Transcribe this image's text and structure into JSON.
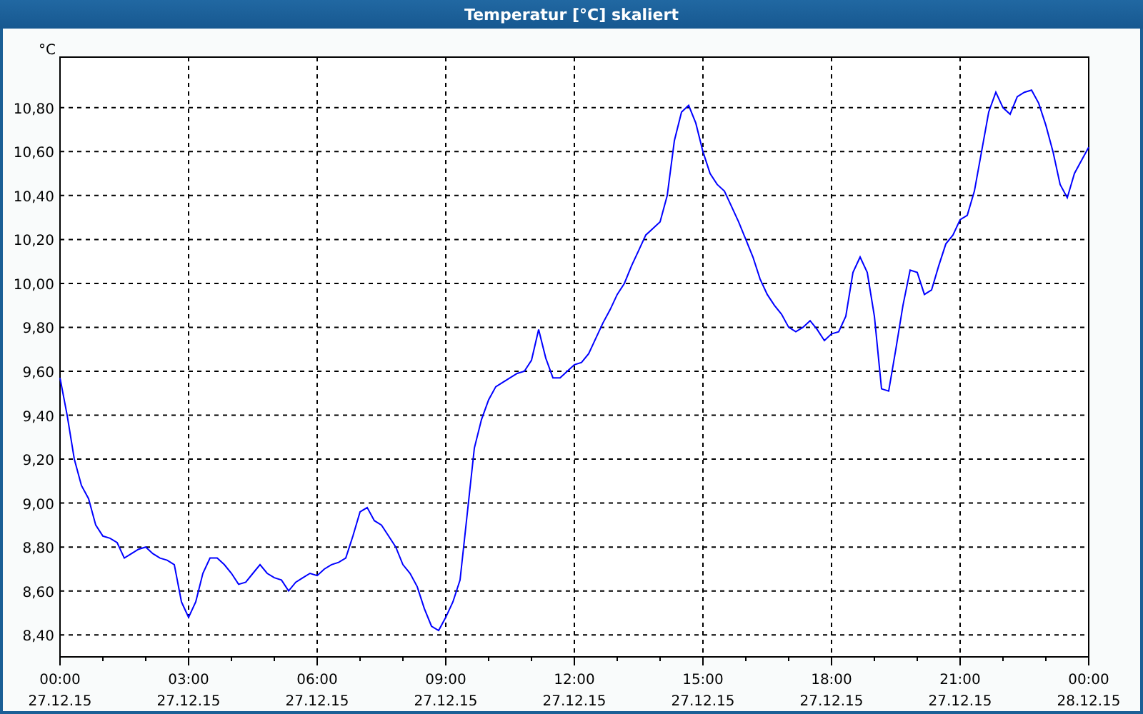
{
  "window": {
    "title": "Temperatur [°C] skaliert"
  },
  "chart_data": {
    "type": "line",
    "ylabel": "°C",
    "ylim": [
      8.3,
      11.03
    ],
    "grid": true,
    "yticks": [
      {
        "value": 8.4,
        "label": "8,40"
      },
      {
        "value": 8.6,
        "label": "8,60"
      },
      {
        "value": 8.8,
        "label": "8,80"
      },
      {
        "value": 9.0,
        "label": "9,00"
      },
      {
        "value": 9.2,
        "label": "9,20"
      },
      {
        "value": 9.4,
        "label": "9,40"
      },
      {
        "value": 9.6,
        "label": "9,60"
      },
      {
        "value": 9.8,
        "label": "9,80"
      },
      {
        "value": 10.0,
        "label": "10,00"
      },
      {
        "value": 10.2,
        "label": "10,20"
      },
      {
        "value": 10.4,
        "label": "10,40"
      },
      {
        "value": 10.6,
        "label": "10,60"
      },
      {
        "value": 10.8,
        "label": "10,80"
      }
    ],
    "categories": [
      "00:00 27.12.15",
      null,
      null,
      null,
      null,
      null,
      null,
      null,
      null,
      null,
      null,
      null,
      null,
      null,
      null,
      null,
      null,
      null,
      "03:00 27.12.15",
      null,
      null,
      null,
      null,
      null,
      null,
      null,
      null,
      null,
      null,
      null,
      null,
      null,
      null,
      null,
      null,
      null,
      "06:00 27.12.15",
      null,
      null,
      null,
      null,
      null,
      null,
      null,
      null,
      null,
      null,
      null,
      null,
      null,
      null,
      null,
      null,
      null,
      "09:00 27.12.15",
      null,
      null,
      null,
      null,
      null,
      null,
      null,
      null,
      null,
      null,
      null,
      null,
      null,
      null,
      null,
      null,
      null,
      "12:00 27.12.15",
      null,
      null,
      null,
      null,
      null,
      null,
      null,
      null,
      null,
      null,
      null,
      null,
      null,
      null,
      null,
      null,
      null,
      "15:00 27.12.15",
      null,
      null,
      null,
      null,
      null,
      null,
      null,
      null,
      null,
      null,
      null,
      null,
      null,
      null,
      null,
      null,
      null,
      "18:00 27.12.15",
      null,
      null,
      null,
      null,
      null,
      null,
      null,
      null,
      null,
      null,
      null,
      null,
      null,
      null,
      null,
      null,
      null,
      "21:00 27.12.15",
      null,
      null,
      null,
      null,
      null,
      null,
      null,
      null,
      null,
      null,
      null,
      null,
      null,
      null,
      null,
      null,
      null,
      "00:00 28.12.15"
    ],
    "series": [
      {
        "color": "#0000ff",
        "values": [
          9.57,
          9.4,
          9.2,
          9.08,
          9.02,
          8.9,
          8.85,
          8.84,
          8.82,
          8.75,
          8.77,
          8.79,
          8.8,
          8.77,
          8.75,
          8.74,
          8.72,
          8.55,
          8.48,
          8.55,
          8.68,
          8.75,
          8.75,
          8.72,
          8.68,
          8.63,
          8.64,
          8.68,
          8.72,
          8.68,
          8.66,
          8.65,
          8.6,
          8.64,
          8.66,
          8.68,
          8.67,
          8.7,
          8.72,
          8.73,
          8.75,
          8.85,
          8.96,
          8.98,
          8.92,
          8.9,
          8.85,
          8.8,
          8.72,
          8.68,
          8.62,
          8.52,
          8.44,
          8.42,
          8.48,
          8.55,
          8.65,
          8.95,
          9.25,
          9.38,
          9.47,
          9.53,
          9.55,
          9.57,
          9.59,
          9.6,
          9.65,
          9.79,
          9.66,
          9.57,
          9.57,
          9.6,
          9.63,
          9.64,
          9.68,
          9.75,
          9.82,
          9.88,
          9.95,
          10.0,
          10.08,
          10.15,
          10.22,
          10.25,
          10.28,
          10.4,
          10.65,
          10.78,
          10.81,
          10.73,
          10.6,
          10.5,
          10.45,
          10.42,
          10.35,
          10.28,
          10.2,
          10.12,
          10.02,
          9.95,
          9.9,
          9.86,
          9.8,
          9.78,
          9.8,
          9.83,
          9.79,
          9.74,
          9.77,
          9.78,
          9.85,
          10.05,
          10.12,
          10.05,
          9.85,
          9.52,
          9.51,
          9.7,
          9.9,
          10.06,
          10.05,
          9.95,
          9.97,
          10.08,
          10.18,
          10.22,
          10.29,
          10.31,
          10.42,
          10.6,
          10.78,
          10.87,
          10.8,
          10.77,
          10.85,
          10.87,
          10.88,
          10.82,
          10.72,
          10.6,
          10.45,
          10.39,
          10.5,
          10.56,
          10.62
        ]
      }
    ]
  }
}
